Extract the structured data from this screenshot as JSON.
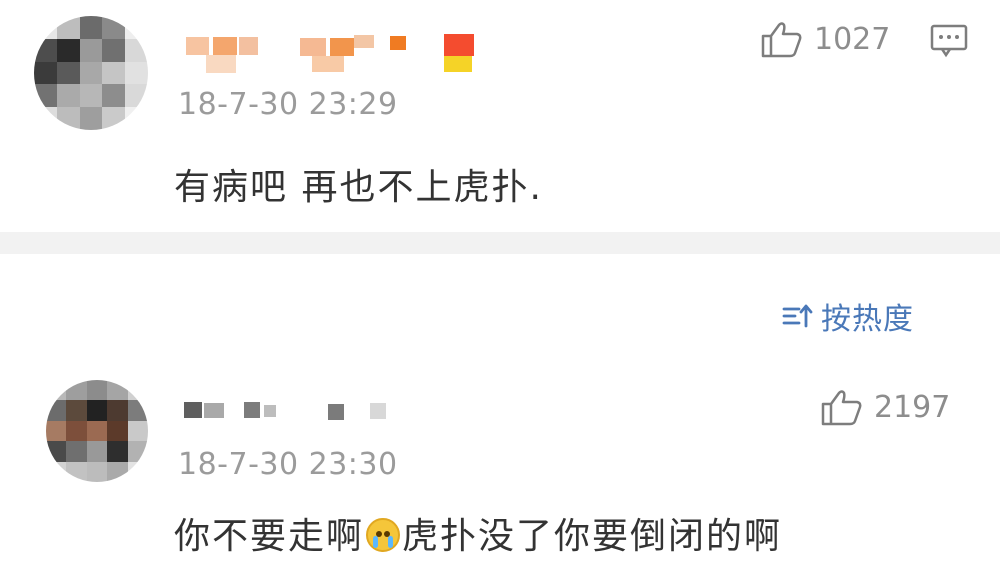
{
  "comments": [
    {
      "time": "18-7-30 23:29",
      "text": "有病吧 再也不上虎扑.",
      "likes": "1027",
      "icons": [
        "avatar",
        "thumbs-up-icon",
        "comment-icon"
      ]
    },
    {
      "time": "18-7-30 23:30",
      "text_before_emoji": "你不要走啊",
      "text_after_emoji": "虎扑没了你要倒闭的啊",
      "emoji": "crying-face-emoji",
      "likes": "2197",
      "icons": [
        "avatar",
        "thumbs-up-icon"
      ]
    }
  ],
  "sort": {
    "label": "按热度",
    "icon": "sort-icon"
  },
  "colors": {
    "background": "#ffffff",
    "separator": "#f2f2f2",
    "time": "#9b9b9b",
    "text": "#333333",
    "link": "#4a78b8"
  }
}
